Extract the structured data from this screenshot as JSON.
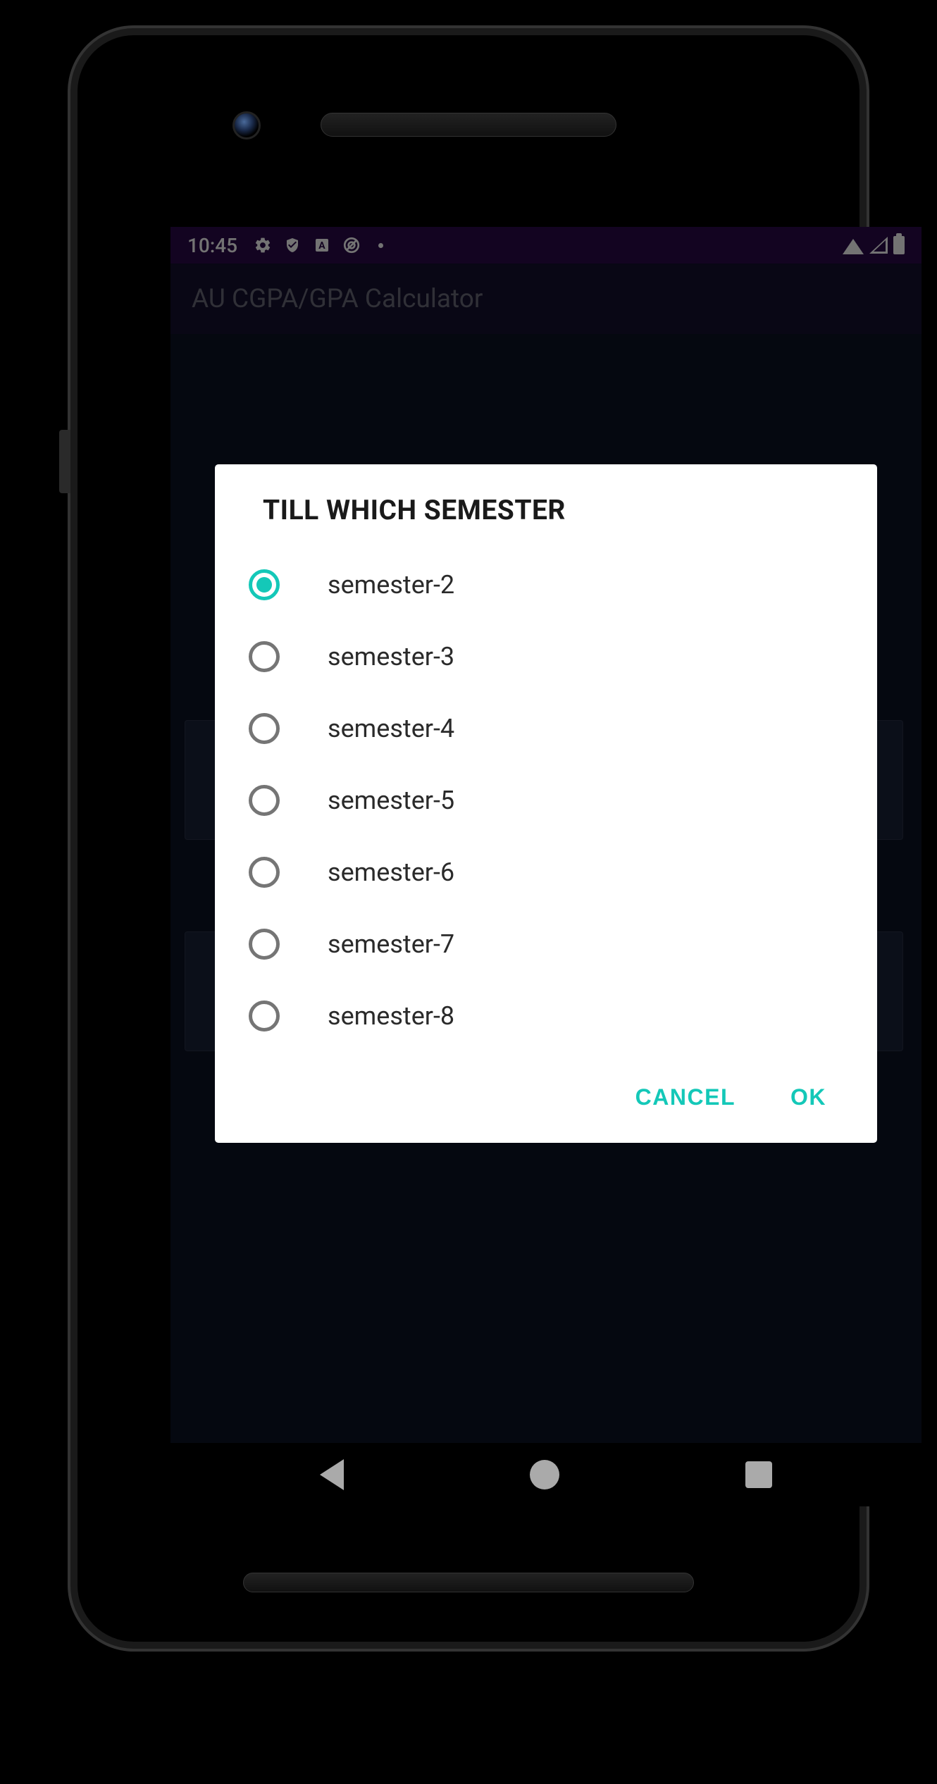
{
  "status": {
    "time": "10:45"
  },
  "appbar": {
    "title": "AU CGPA/GPA Calculator"
  },
  "dialog": {
    "title": "TILL WHICH SEMESTER",
    "selected_index": 0,
    "options": [
      {
        "label": "semester-2"
      },
      {
        "label": "semester-3"
      },
      {
        "label": "semester-4"
      },
      {
        "label": "semester-5"
      },
      {
        "label": "semester-6"
      },
      {
        "label": "semester-7"
      },
      {
        "label": "semester-8"
      }
    ],
    "cancel_label": "CANCEL",
    "ok_label": "OK"
  },
  "colors": {
    "accent": "#14c8b8",
    "status_bg": "#2a0a4a",
    "app_bg": "#0d1324"
  }
}
